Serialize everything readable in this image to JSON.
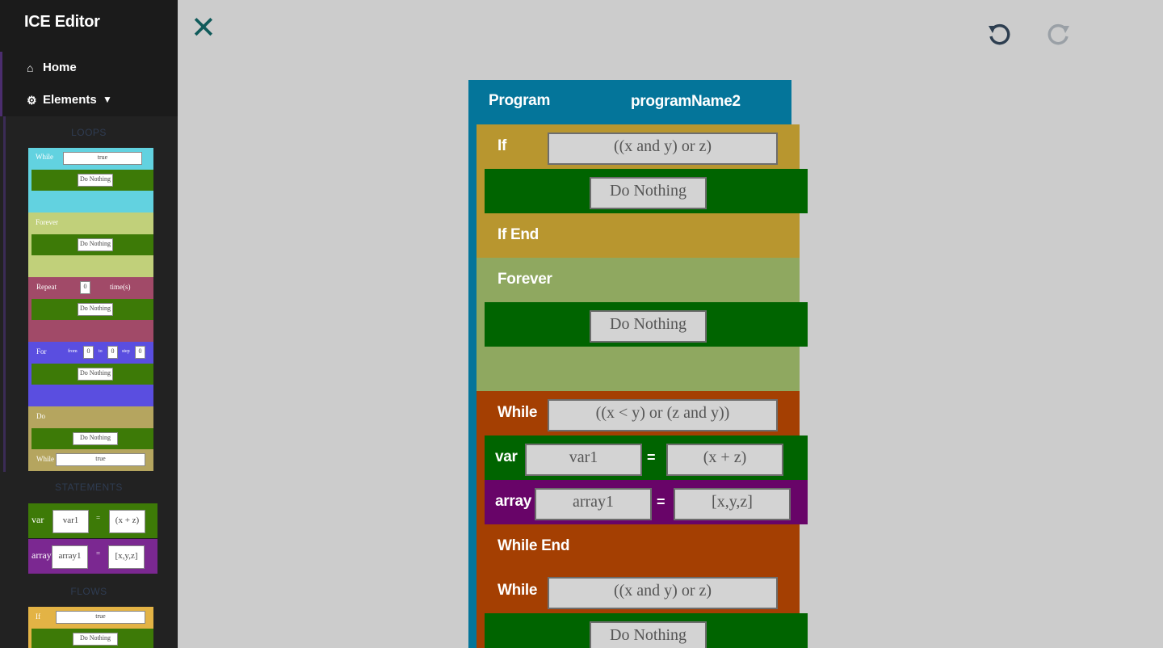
{
  "app": {
    "title": "ICE Editor"
  },
  "sidebar": {
    "nav": [
      {
        "label": "Home",
        "icon": "home-icon"
      },
      {
        "label": "Elements",
        "icon": "gear-icon",
        "caret": "chevron-down-icon"
      }
    ],
    "categories": [
      "LOOPS",
      "STATEMENTS",
      "FLOWS"
    ],
    "palette": {
      "while": {
        "label": "While",
        "condition": "true",
        "body": "Do Nothing"
      },
      "forever": {
        "label": "Forever",
        "body": "Do Nothing"
      },
      "repeat": {
        "label": "Repeat",
        "count": "0",
        "suffix": "time(s)",
        "body": "Do Nothing"
      },
      "for": {
        "label": "For",
        "from_label": "from",
        "from": "0",
        "to_label": "to",
        "to": "0",
        "step_label": "step",
        "step": "0",
        "body": "Do Nothing"
      },
      "do": {
        "label": "Do",
        "body": "Do Nothing",
        "while_label": "While",
        "condition": "true"
      },
      "var": {
        "label": "var",
        "name": "var1",
        "eq": "=",
        "value": "(x + z)"
      },
      "array": {
        "label": "array",
        "name": "array1",
        "eq": "=",
        "value": "[x,y,z]"
      },
      "if": {
        "label": "If",
        "condition": "true",
        "body": "Do Nothing"
      }
    }
  },
  "toolbar": {
    "close_icon": "close-icon",
    "undo_icon": "undo-icon",
    "redo_icon": "redo-icon"
  },
  "program": {
    "label": "Program",
    "name": "programName2",
    "blocks": {
      "if": {
        "label": "If",
        "condition": "((x and y) or z)",
        "body": "Do Nothing",
        "end": "If End"
      },
      "forever": {
        "label": "Forever",
        "body": "Do Nothing"
      },
      "while1": {
        "label": "While",
        "condition": "((x < y) or (z and y))",
        "var": {
          "label": "var",
          "name": "var1",
          "eq": "=",
          "value": "(x + z)"
        },
        "array": {
          "label": "array",
          "name": "array1",
          "eq": "=",
          "value": "[x,y,z]"
        },
        "end": "While End"
      },
      "while2": {
        "label": "While",
        "condition": "((x and y) or z)",
        "body": "Do Nothing"
      }
    }
  },
  "colors": {
    "program": "#04759a",
    "if": "#b8962f",
    "do_nothing": "#006400",
    "forever": "#8fa860",
    "while": "#a43f02",
    "var": "#006400",
    "array": "#680468"
  }
}
